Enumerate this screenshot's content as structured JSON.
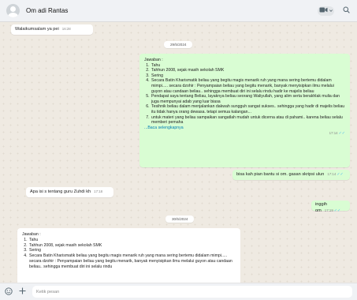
{
  "header": {
    "contact_name": "Om adi Rantas"
  },
  "messages": [
    {
      "type": "in",
      "text": "Walaikumsalam ya pei",
      "time": "16:28"
    },
    {
      "type": "date",
      "text": "29/5/2024"
    },
    {
      "type": "out",
      "title": "Jawaban :",
      "items": [
        "Tahu",
        "Tahhun 2008, sejak masih sekolah SMK",
        "Sering",
        "Secara Batin Kharismatik beliau yang begitu magis menarik ruh yang mana sering bertemu didalam mimpi..... secara dzohir : Penyampaian beliau yang begitu menarik, banyak menyisipkan ilmu melalui guyon atau candaan beliau.. sehingga membuat diri ini selalu rindu hadir ke majelis beliau",
        "Pendapat saya tentang Beliau, layaknya beliau seorang Waliyullah, yang alim serta berakhlak mulia dan juga mempunyai adab yang luar biasa",
        "Tesihnik beliau dalam menjalankan dakwah sungguh sangat sukses.. sehingga yang hadir di majelis beliau itu tidak hanya orang dewasa. tetapi semua kalangan...",
        "untuk materi yang beliau sampaikan sangatlah mudah untuk dicerna atau di pahami.. karena beliau selalu memberi pemaha"
      ],
      "read_more": "...Baca selengkapnya",
      "time": "17:14"
    },
    {
      "type": "out",
      "text": "bisa kah pian bantu si om. gasan skripsi ulun",
      "time": "17:14"
    },
    {
      "type": "in",
      "text": "Apa isi s tentang guru Zuhdi kh",
      "time": "17:18"
    },
    {
      "type": "out",
      "text": "inggih om",
      "time": "17:19"
    },
    {
      "type": "date",
      "text": "30/5/2024"
    },
    {
      "type": "in",
      "title": "Jawaban :",
      "items": [
        "Tahu",
        "Tahhun 2008, sejak masih sekolah SMK",
        "Sering",
        "Secara Batin Kharismatik beliau yang begitu magis menarik ruh yang mana sering bertemu didalam mimpi..... secara dzohir : Penyampaian beliau yang begitu menarik, banyak menyisipkan ilmu melalui guyon atau candaan beliau.. sehingga membuat diri ini selalu rindu"
      ]
    }
  ],
  "composer": {
    "placeholder": "Ketik pesan"
  },
  "icons": {
    "video": "video-call-icon",
    "search": "search-icon",
    "emoji": "emoji-icon",
    "attach": "plus-icon"
  }
}
